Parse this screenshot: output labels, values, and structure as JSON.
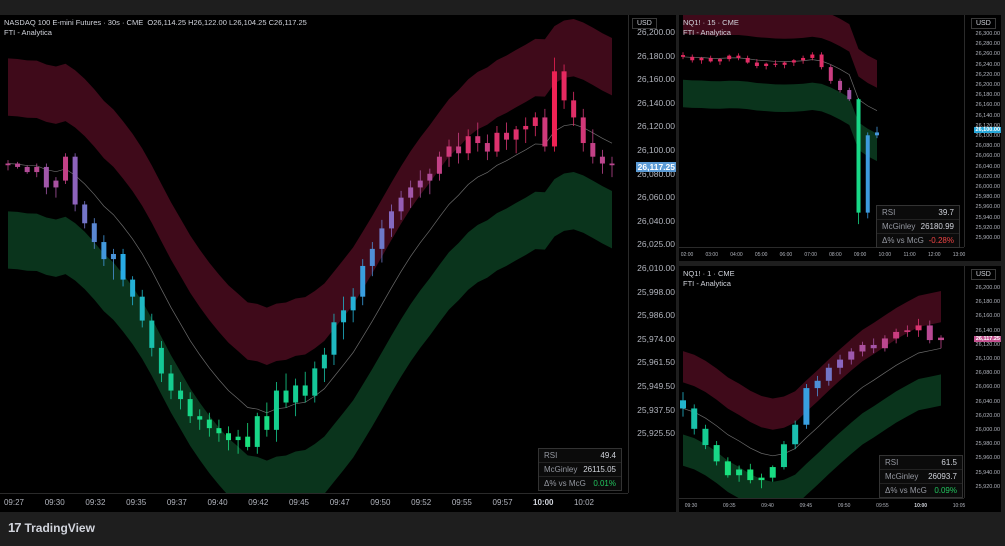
{
  "brand": {
    "logo_mark": "17",
    "name": "TradingView"
  },
  "charts": [
    {
      "id": "main",
      "title": "NASDAQ 100 E-mini Futures · 30s · CME",
      "ohlc": "O26,114.25  H26,122.00  L26,104.25  C26,117.25",
      "indicator": "FTI - Analytica",
      "currency": "USD",
      "price_labels": [
        "26,200.00",
        "26,180.00",
        "26,160.00",
        "26,140.00",
        "26,120.00",
        "26,100.00",
        "26,080.00",
        "26,060.00",
        "26,040.00",
        "26,025.00",
        "26,010.00",
        "25,998.00",
        "25,986.00",
        "25,974.00",
        "25,961.50",
        "25,949.50",
        "25,937.50",
        "25,925.50"
      ],
      "last_price": "26,117.25",
      "time_labels": [
        "09:27",
        "09:30",
        "09:32",
        "09:35",
        "09:37",
        "09:40",
        "09:42",
        "09:45",
        "09:47",
        "09:50",
        "09:52",
        "09:55",
        "09:57",
        "10:00",
        "10:02"
      ],
      "bold_time": "10:00",
      "stats": [
        {
          "label": "RSI",
          "value": "49.4"
        },
        {
          "label": "McGinley",
          "value": "26115.05"
        },
        {
          "label": "Δ% vs McG",
          "value": "0.01%"
        }
      ],
      "colors": {
        "delta": "#22c55e"
      }
    },
    {
      "id": "top-right",
      "title": "NQ1! · 15 · CME",
      "indicator": "FTI - Analytica",
      "currency": "USD",
      "price_labels": [
        "26,300.00",
        "26,280.00",
        "26,260.00",
        "26,240.00",
        "26,220.00",
        "26,200.00",
        "26,180.00",
        "26,160.00",
        "26,140.00",
        "26,120.00",
        "26,100.00",
        "26,080.00",
        "26,060.00",
        "26,040.00",
        "26,020.00",
        "26,000.00",
        "25,980.00",
        "25,960.00",
        "25,940.00",
        "25,920.00",
        "25,900.00"
      ],
      "last_price": "26,100.00",
      "time_labels": [
        "02:00",
        "03:00",
        "04:00",
        "05:00",
        "06:00",
        "07:00",
        "08:00",
        "09:00",
        "10:00",
        "11:00",
        "12:00",
        "13:00"
      ],
      "stats": [
        {
          "label": "RSI",
          "value": "39.7"
        },
        {
          "label": "McGinley",
          "value": "26180.99"
        },
        {
          "label": "Δ% vs McG",
          "value": "-0.28%"
        }
      ],
      "colors": {
        "delta": "#ef4444"
      }
    },
    {
      "id": "bottom-right",
      "title": "NQ1! · 1 · CME",
      "indicator": "FTI - Analytica",
      "currency": "USD",
      "price_labels": [
        "26,200.00",
        "26,180.00",
        "26,160.00",
        "26,140.00",
        "26,120.00",
        "26,100.00",
        "26,080.00",
        "26,060.00",
        "26,040.00",
        "26,020.00",
        "26,000.00",
        "25,980.00",
        "25,960.00",
        "25,940.00",
        "25,920.00"
      ],
      "last_price": "26,117.25",
      "time_labels": [
        "09:30",
        "09:35",
        "09:40",
        "09:45",
        "09:50",
        "09:55",
        "10:00",
        "10:05"
      ],
      "bold_time": "10:00",
      "stats": [
        {
          "label": "RSI",
          "value": "61.5"
        },
        {
          "label": "McGinley",
          "value": "26093.7"
        },
        {
          "label": "Δ% vs McG",
          "value": "0.09%"
        }
      ],
      "colors": {
        "delta": "#22c55e"
      }
    }
  ],
  "candles": {
    "main": [
      [
        26117,
        26120,
        26114,
        26118
      ],
      [
        26118,
        26119,
        26115,
        26116
      ],
      [
        26116,
        26117,
        26112,
        26113
      ],
      [
        26113,
        26118,
        26110,
        26116
      ],
      [
        26116,
        26118,
        26100,
        26104
      ],
      [
        26104,
        26110,
        26098,
        26108
      ],
      [
        26108,
        26124,
        26106,
        26122
      ],
      [
        26122,
        26124,
        26090,
        26094
      ],
      [
        26094,
        26096,
        26080,
        26083
      ],
      [
        26083,
        26086,
        26068,
        26072
      ],
      [
        26072,
        26076,
        26058,
        26062
      ],
      [
        26062,
        26068,
        26050,
        26065
      ],
      [
        26065,
        26068,
        26046,
        26050
      ],
      [
        26050,
        26052,
        26035,
        26040
      ],
      [
        26040,
        26044,
        26022,
        26026
      ],
      [
        26026,
        26030,
        26005,
        26010
      ],
      [
        26010,
        26014,
        25990,
        25995
      ],
      [
        25995,
        26000,
        25980,
        25985
      ],
      [
        25985,
        25990,
        25974,
        25980
      ],
      [
        25980,
        25984,
        25966,
        25970
      ],
      [
        25970,
        25974,
        25962,
        25968
      ],
      [
        25968,
        25972,
        25958,
        25963
      ],
      [
        25963,
        25968,
        25955,
        25960
      ],
      [
        25960,
        25964,
        25950,
        25956
      ],
      [
        25956,
        25962,
        25948,
        25958
      ],
      [
        25958,
        25966,
        25950,
        25952
      ],
      [
        25952,
        25972,
        25948,
        25970
      ],
      [
        25970,
        25978,
        25958,
        25962
      ],
      [
        25962,
        25990,
        25955,
        25985
      ],
      [
        25985,
        25995,
        25975,
        25978
      ],
      [
        25978,
        25992,
        25970,
        25988
      ],
      [
        25988,
        25996,
        25978,
        25982
      ],
      [
        25982,
        26002,
        25978,
        25998
      ],
      [
        25998,
        26010,
        25990,
        26006
      ],
      [
        26006,
        26030,
        26000,
        26025
      ],
      [
        26025,
        26040,
        26015,
        26032
      ],
      [
        26032,
        26045,
        26025,
        26040
      ],
      [
        26040,
        26062,
        26035,
        26058
      ],
      [
        26058,
        26072,
        26052,
        26068
      ],
      [
        26068,
        26085,
        26060,
        26080
      ],
      [
        26080,
        26094,
        26075,
        26090
      ],
      [
        26090,
        26102,
        26085,
        26098
      ],
      [
        26098,
        26108,
        26092,
        26104
      ],
      [
        26104,
        26114,
        26098,
        26108
      ],
      [
        26108,
        26115,
        26100,
        26112
      ],
      [
        26112,
        26125,
        26108,
        26122
      ],
      [
        26122,
        26132,
        26116,
        26128
      ],
      [
        26128,
        26136,
        26118,
        26124
      ],
      [
        26124,
        26138,
        26120,
        26134
      ],
      [
        26134,
        26142,
        26125,
        26130
      ],
      [
        26130,
        26135,
        26120,
        26125
      ],
      [
        26125,
        26140,
        26122,
        26136
      ],
      [
        26136,
        26142,
        26126,
        26132
      ],
      [
        26132,
        26140,
        26124,
        26138
      ],
      [
        26138,
        26145,
        26130,
        26140
      ],
      [
        26140,
        26148,
        26134,
        26145
      ],
      [
        26145,
        26150,
        26125,
        26128
      ],
      [
        26128,
        26180,
        26125,
        26172
      ],
      [
        26172,
        26176,
        26150,
        26155
      ],
      [
        26155,
        26160,
        26140,
        26145
      ],
      [
        26145,
        26150,
        26125,
        26130
      ],
      [
        26130,
        26138,
        26118,
        26122
      ],
      [
        26122,
        26126,
        26112,
        26118
      ],
      [
        26118,
        26122,
        26110,
        26117
      ]
    ],
    "tr": [
      [
        26235,
        26240,
        26228,
        26232
      ],
      [
        26232,
        26236,
        26222,
        26226
      ],
      [
        26226,
        26232,
        26220,
        26230
      ],
      [
        26230,
        26234,
        26222,
        26224
      ],
      [
        26224,
        26230,
        26218,
        26228
      ],
      [
        26228,
        26236,
        26224,
        26234
      ],
      [
        26234,
        26238,
        26226,
        26230
      ],
      [
        26230,
        26234,
        26220,
        26222
      ],
      [
        26222,
        26228,
        26212,
        26216
      ],
      [
        26216,
        26222,
        26210,
        26220
      ],
      [
        26220,
        26226,
        26214,
        26218
      ],
      [
        26218,
        26224,
        26212,
        26222
      ],
      [
        26222,
        26228,
        26216,
        26226
      ],
      [
        26226,
        26234,
        26220,
        26230
      ],
      [
        26230,
        26240,
        26226,
        26236
      ],
      [
        26236,
        26240,
        26210,
        26214
      ],
      [
        26214,
        26218,
        26185,
        26190
      ],
      [
        26190,
        26194,
        26170,
        26174
      ],
      [
        26174,
        26178,
        26155,
        26158
      ],
      [
        26158,
        26160,
        25940,
        25960
      ],
      [
        25960,
        26100,
        25950,
        26095
      ],
      [
        26095,
        26110,
        26090,
        26100
      ]
    ],
    "br": [
      [
        26040,
        26050,
        26020,
        26030
      ],
      [
        26030,
        26035,
        25998,
        26005
      ],
      [
        26005,
        26010,
        25980,
        25985
      ],
      [
        25985,
        25990,
        25960,
        25965
      ],
      [
        25965,
        25970,
        25945,
        25948
      ],
      [
        25948,
        25960,
        25940,
        25955
      ],
      [
        25955,
        25962,
        25938,
        25942
      ],
      [
        25942,
        25950,
        25932,
        25945
      ],
      [
        25945,
        25960,
        25940,
        25958
      ],
      [
        25958,
        25990,
        25955,
        25986
      ],
      [
        25986,
        26015,
        25980,
        26010
      ],
      [
        26010,
        26060,
        26005,
        26055
      ],
      [
        26055,
        26070,
        26045,
        26064
      ],
      [
        26064,
        26085,
        26058,
        26080
      ],
      [
        26080,
        26096,
        26072,
        26090
      ],
      [
        26090,
        26104,
        26084,
        26100
      ],
      [
        26100,
        26112,
        26094,
        26108
      ],
      [
        26108,
        26116,
        26098,
        26104
      ],
      [
        26104,
        26120,
        26100,
        26116
      ],
      [
        26116,
        26128,
        26110,
        26124
      ],
      [
        26124,
        26132,
        26118,
        26126
      ],
      [
        26126,
        26140,
        26118,
        26132
      ],
      [
        26132,
        26138,
        26110,
        26114
      ],
      [
        26114,
        26120,
        26104,
        26117
      ]
    ]
  }
}
